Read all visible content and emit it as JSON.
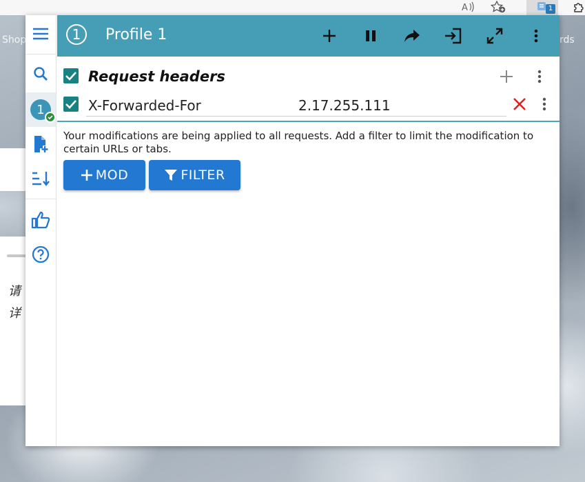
{
  "browser": {
    "read_aloud_icon": "read-aloud-icon",
    "add_favorite_icon": "add-favorite-icon",
    "extension_badge": "1",
    "bg_left_text": "Shop",
    "bg_right_text": "rds",
    "bg_cjk_line1": "请",
    "bg_cjk_line2": "详"
  },
  "sidebar": {
    "items": [
      {
        "name": "menu",
        "icon": "menu-icon"
      },
      {
        "name": "search",
        "icon": "search-icon"
      },
      {
        "name": "profile",
        "label": "1",
        "status": "active"
      },
      {
        "name": "add-profile",
        "icon": "file-add-icon"
      },
      {
        "name": "sort",
        "icon": "sort-icon"
      },
      {
        "name": "rate",
        "icon": "thumbs-up-icon"
      },
      {
        "name": "help",
        "icon": "help-icon"
      }
    ]
  },
  "header": {
    "profile_number": "1",
    "title": "Profile 1",
    "actions": [
      "add",
      "pause",
      "share",
      "import",
      "expand",
      "more"
    ]
  },
  "section": {
    "title": "Request headers",
    "checked": true
  },
  "header_rows": [
    {
      "name": "X-Forwarded-For",
      "value": "2.17.255.111",
      "checked": true
    }
  ],
  "info": {
    "message": "Your modifications are being applied to all requests. Add a filter to limit the modification to certain URLs or tabs."
  },
  "buttons": {
    "mod_label": "MOD",
    "filter_label": "FILTER"
  },
  "colors": {
    "header_bg": "#469db6",
    "checkbox": "#188181",
    "button": "#2378d1",
    "delete": "#e02020",
    "sidebar_icon": "#2378d1"
  }
}
